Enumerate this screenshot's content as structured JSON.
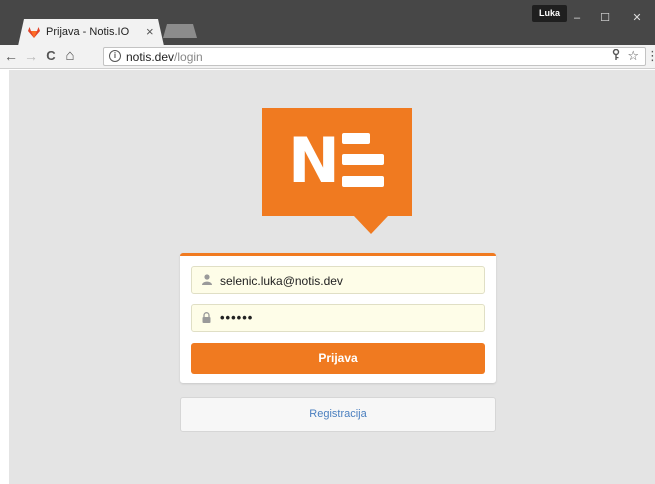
{
  "browser": {
    "tab": {
      "title": "Prijava - Notis.IO",
      "close_label": "×"
    },
    "profile_name": "Luka",
    "window_controls": {
      "minimize": "–",
      "maximize": "☐",
      "close": "✕"
    },
    "nav": {
      "back": "←",
      "forward": "→",
      "reload": "C",
      "home": "⌂"
    },
    "url": {
      "host": "notis.dev",
      "path": "/login"
    },
    "icons": {
      "info": "i",
      "key": "🔑",
      "star": "☆",
      "menu": "⋮"
    }
  },
  "login": {
    "email_value": "selenic.luka@notis.dev",
    "password_masked": "••••••",
    "submit_label": "Prijava"
  },
  "register_label": "Registracija",
  "colors": {
    "brand": "#f07a20",
    "link": "#4a7fbf",
    "field_bg": "#fefde8"
  }
}
